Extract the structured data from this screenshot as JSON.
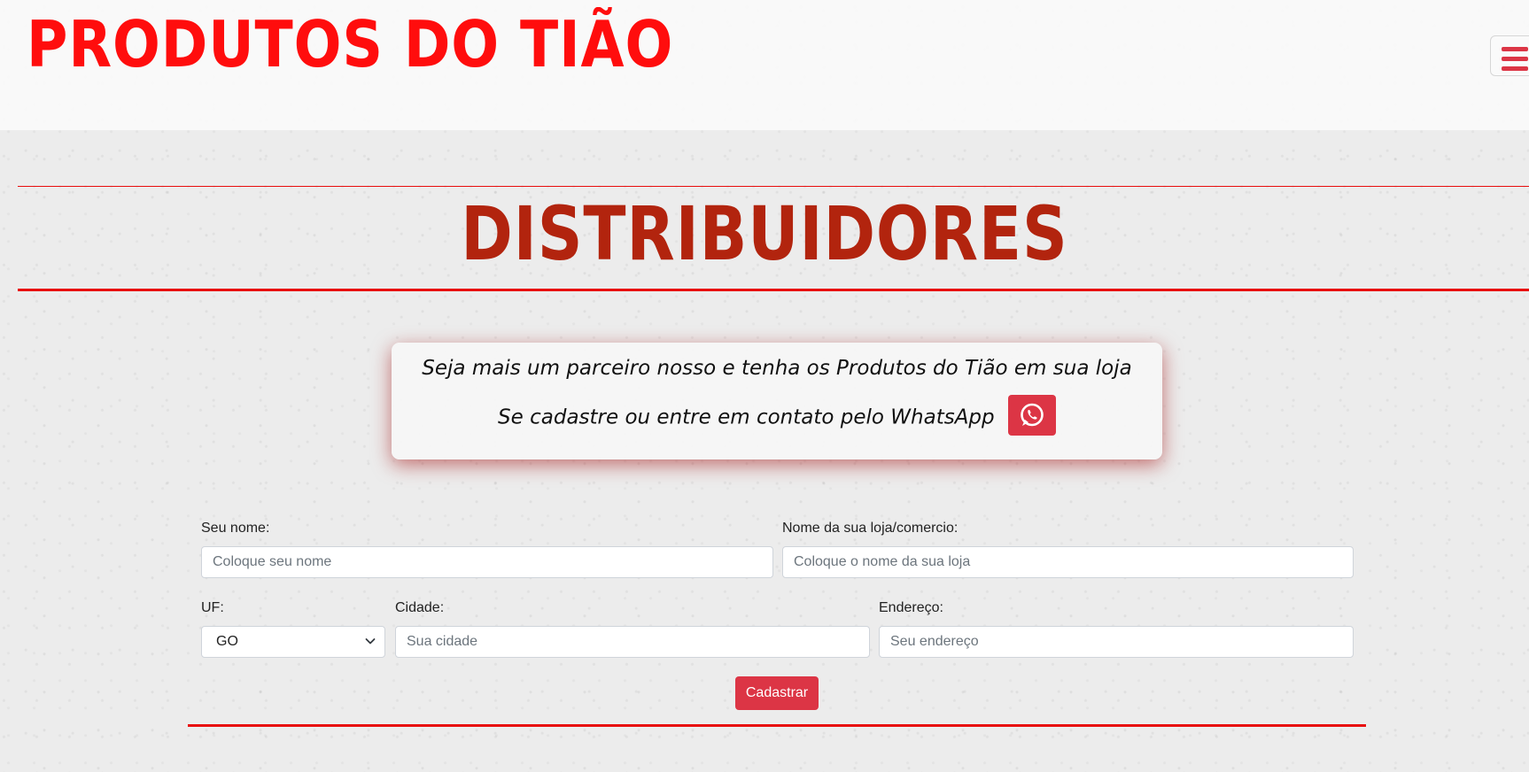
{
  "colors": {
    "brand_red": "#ff0d0d",
    "title_red": "#b2240e",
    "rule_red": "#e80e0e",
    "button_red": "#dc3545"
  },
  "header": {
    "brand": "PRODUTOS DO TIÃO",
    "menu_icon": "hamburger-menu-icon"
  },
  "section": {
    "title": "DISTRIBUIDORES"
  },
  "card": {
    "line1": "Seja mais um parceiro nosso e tenha os Produtos do Tião em sua loja",
    "line2": "Se cadastre ou entre em contato pelo WhatsApp",
    "whatsapp_icon": "whatsapp-icon"
  },
  "form": {
    "name": {
      "label": "Seu nome:",
      "placeholder": "Coloque seu nome"
    },
    "store": {
      "label": "Nome da sua loja/comercio:",
      "placeholder": "Coloque o nome da sua loja"
    },
    "uf": {
      "label": "UF:",
      "selected": "GO"
    },
    "city": {
      "label": "Cidade:",
      "placeholder": "Sua cidade"
    },
    "address": {
      "label": "Endereço:",
      "placeholder": "Seu endereço"
    },
    "submit_label": "Cadastrar"
  }
}
